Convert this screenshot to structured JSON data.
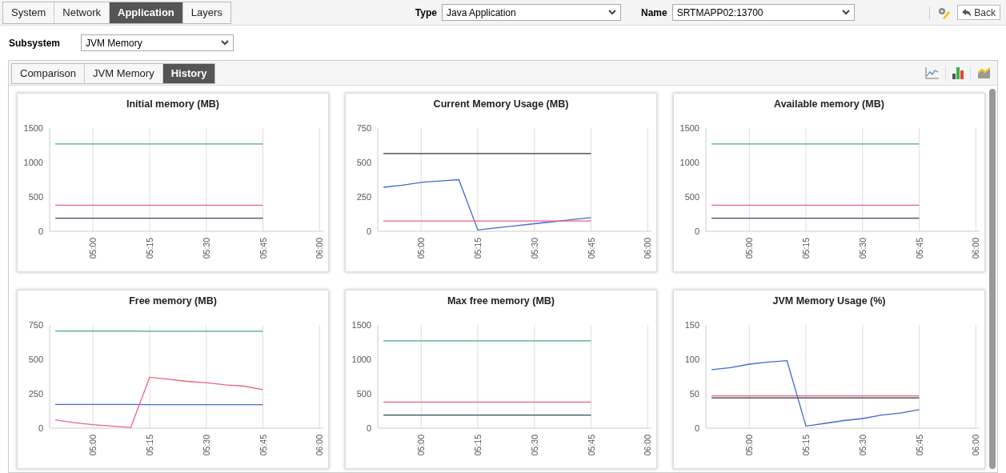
{
  "top_tabs": [
    {
      "label": "System",
      "selected": false
    },
    {
      "label": "Network",
      "selected": false
    },
    {
      "label": "Application",
      "selected": true
    },
    {
      "label": "Layers",
      "selected": false
    }
  ],
  "type_field": {
    "label": "Type",
    "value": "Java Application"
  },
  "name_field": {
    "label": "Name",
    "value": "SRTMAPP02:13700"
  },
  "back_button": "Back",
  "subsystem": {
    "label": "Subsystem",
    "value": "JVM Memory"
  },
  "view_tabs": [
    {
      "label": "Comparison",
      "selected": false
    },
    {
      "label": "JVM Memory",
      "selected": false
    },
    {
      "label": "History",
      "selected": true
    }
  ],
  "charts": [
    {
      "chart_data": {
        "type": "line",
        "grid": true,
        "title": "Initial memory (MB)",
        "categories": [
          null,
          null,
          "05:00",
          null,
          null,
          "05:15",
          null,
          null,
          "05:30",
          null,
          null,
          "05:45",
          null,
          null,
          "06:00"
        ],
        "ylim": [
          0,
          1500
        ],
        "yticks": [
          0,
          500,
          1000,
          1500
        ],
        "series": [
          {
            "color": "#45a88c",
            "values": [
              1270,
              1270,
              1270,
              1270,
              1270,
              1270,
              1270,
              1270,
              1270,
              1270,
              1270,
              1270,
              null,
              null,
              null
            ]
          },
          {
            "color": "#f0607a",
            "values": [
              380,
              380,
              380,
              380,
              380,
              380,
              380,
              380,
              380,
              380,
              380,
              380,
              null,
              null,
              null
            ]
          },
          {
            "color": "#34495e",
            "values": [
              190,
              190,
              190,
              190,
              190,
              190,
              190,
              190,
              190,
              190,
              190,
              190,
              null,
              null,
              null
            ]
          }
        ]
      }
    },
    {
      "chart_data": {
        "type": "line",
        "grid": true,
        "title": "Current Memory Usage (MB)",
        "categories": [
          null,
          null,
          "05:00",
          null,
          null,
          "05:15",
          null,
          null,
          "05:30",
          null,
          null,
          "05:45",
          null,
          null,
          "06:00"
        ],
        "ylim": [
          0,
          750
        ],
        "yticks": [
          0,
          250,
          500,
          750
        ],
        "series": [
          {
            "color": "#333333",
            "values": [
              565,
              565,
              565,
              565,
              565,
              565,
              565,
              565,
              565,
              565,
              565,
              565,
              null,
              null,
              null
            ]
          },
          {
            "color": "#4169cf",
            "values": [
              320,
              335,
              355,
              365,
              375,
              10,
              25,
              40,
              55,
              70,
              85,
              100,
              null,
              null,
              null
            ]
          },
          {
            "color": "#f0607a",
            "values": [
              75,
              75,
              75,
              75,
              75,
              75,
              75,
              75,
              75,
              75,
              75,
              75,
              null,
              null,
              null
            ]
          }
        ]
      }
    },
    {
      "chart_data": {
        "type": "line",
        "grid": true,
        "title": "Available memory (MB)",
        "categories": [
          null,
          null,
          "05:00",
          null,
          null,
          "05:15",
          null,
          null,
          "05:30",
          null,
          null,
          "05:45",
          null,
          null,
          "06:00"
        ],
        "ylim": [
          0,
          1500
        ],
        "yticks": [
          0,
          500,
          1000,
          1500
        ],
        "series": [
          {
            "color": "#45a88c",
            "values": [
              1270,
              1270,
              1270,
              1270,
              1270,
              1270,
              1270,
              1270,
              1270,
              1270,
              1270,
              1270,
              null,
              null,
              null
            ]
          },
          {
            "color": "#f0607a",
            "values": [
              380,
              380,
              380,
              380,
              380,
              380,
              380,
              380,
              380,
              380,
              380,
              380,
              null,
              null,
              null
            ]
          },
          {
            "color": "#34495e",
            "values": [
              190,
              190,
              190,
              190,
              190,
              190,
              190,
              190,
              190,
              190,
              190,
              190,
              null,
              null,
              null
            ]
          }
        ]
      }
    },
    {
      "chart_data": {
        "type": "line",
        "grid": true,
        "title": "Free memory (MB)",
        "categories": [
          null,
          null,
          "05:00",
          null,
          null,
          "05:15",
          null,
          null,
          "05:30",
          null,
          null,
          "05:45",
          null,
          null,
          "06:00"
        ],
        "ylim": [
          0,
          750
        ],
        "yticks": [
          0,
          250,
          500,
          750
        ],
        "series": [
          {
            "color": "#45a88c",
            "values": [
              705,
              705,
              705,
              705,
              705,
              704,
              704,
              704,
              704,
              704,
              704,
              704,
              null,
              null,
              null
            ]
          },
          {
            "color": "#4169cf",
            "values": [
              172,
              172,
              172,
              172,
              172,
              171,
              171,
              171,
              171,
              171,
              171,
              171,
              null,
              null,
              null
            ]
          },
          {
            "color": "#f0607a",
            "values": [
              60,
              40,
              25,
              15,
              5,
              370,
              355,
              340,
              330,
              315,
              305,
              280,
              null,
              null,
              null
            ]
          }
        ]
      }
    },
    {
      "chart_data": {
        "type": "line",
        "grid": true,
        "title": "Max free memory (MB)",
        "categories": [
          null,
          null,
          "05:00",
          null,
          null,
          "05:15",
          null,
          null,
          "05:30",
          null,
          null,
          "05:45",
          null,
          null,
          "06:00"
        ],
        "ylim": [
          0,
          1500
        ],
        "yticks": [
          0,
          500,
          1000,
          1500
        ],
        "series": [
          {
            "color": "#45a88c",
            "values": [
              1270,
              1270,
              1270,
              1270,
              1270,
              1270,
              1270,
              1270,
              1270,
              1270,
              1270,
              1270,
              null,
              null,
              null
            ]
          },
          {
            "color": "#f0607a",
            "values": [
              380,
              380,
              380,
              380,
              380,
              380,
              380,
              380,
              380,
              380,
              380,
              380,
              null,
              null,
              null
            ]
          },
          {
            "color": "#34495e",
            "values": [
              190,
              190,
              190,
              190,
              190,
              190,
              190,
              190,
              190,
              190,
              190,
              190,
              null,
              null,
              null
            ]
          }
        ]
      }
    },
    {
      "chart_data": {
        "type": "line",
        "grid": true,
        "title": "JVM Memory Usage (%)",
        "categories": [
          null,
          null,
          "05:00",
          null,
          null,
          "05:15",
          null,
          null,
          "05:30",
          null,
          null,
          "05:45",
          null,
          null,
          "06:00"
        ],
        "ylim": [
          0,
          150
        ],
        "yticks": [
          0,
          50,
          100,
          150
        ],
        "series": [
          {
            "color": "#f0607a",
            "values": [
              47,
              47,
              47,
              47,
              47,
              47,
              47,
              47,
              47,
              47,
              47,
              47,
              null,
              null,
              null
            ]
          },
          {
            "color": "#333333",
            "values": [
              44,
              44,
              44,
              44,
              44,
              44,
              44,
              44,
              44,
              44,
              44,
              44,
              null,
              null,
              null
            ]
          },
          {
            "color": "#4169cf",
            "values": [
              85,
              88,
              93,
              96,
              98,
              3,
              7,
              11,
              14,
              19,
              22,
              27,
              null,
              null,
              null
            ]
          }
        ]
      }
    }
  ]
}
